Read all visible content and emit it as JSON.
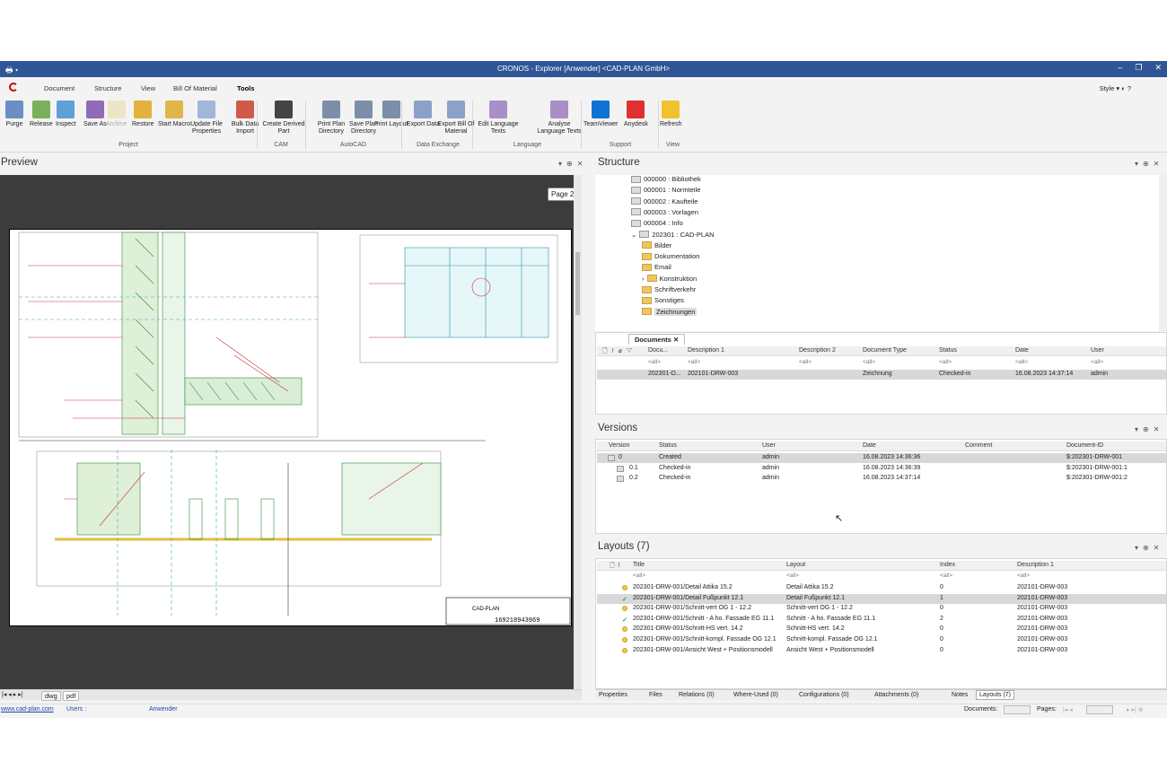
{
  "window": {
    "title": "CRONOS - Explorer [Anwender] <CAD-PLAN GmbH>"
  },
  "menu": {
    "tabs": [
      "Document",
      "Structure",
      "View",
      "Bill Of Material",
      "Tools"
    ],
    "active": "Tools",
    "style_label": "Style"
  },
  "ribbon": {
    "buttons": [
      {
        "label": "Purge",
        "disabled": false,
        "color": "#6b8fc4"
      },
      {
        "label": "Release",
        "disabled": false,
        "color": "#7ab05b"
      },
      {
        "label": "Inspect",
        "disabled": false,
        "color": "#5ea0d8"
      },
      {
        "label": "Save As",
        "disabled": false,
        "color": "#8f6bb8"
      },
      {
        "label": "Archive",
        "disabled": true,
        "color": "#e8d89c"
      },
      {
        "label": "Restore",
        "disabled": false,
        "color": "#e2b23c"
      },
      {
        "label": "Start Macro",
        "disabled": false,
        "color": "#e0b64a"
      },
      {
        "label": "Update File Properties",
        "disabled": false,
        "color": "#9fb7d8"
      },
      {
        "label": "Bulk Data Import",
        "disabled": false,
        "color": "#d05a4a"
      },
      {
        "label": "Create Derived Part",
        "disabled": false,
        "color": "#444444"
      },
      {
        "label": "Print Plan Directory",
        "disabled": false,
        "color": "#7d8fa8"
      },
      {
        "label": "Save Plan Directory",
        "disabled": false,
        "color": "#7d8fa8"
      },
      {
        "label": "Print Layout",
        "disabled": false,
        "color": "#7d8fa8"
      },
      {
        "label": "Export Data",
        "disabled": false,
        "color": "#8aa2c8"
      },
      {
        "label": "Export Bill Of Material",
        "disabled": false,
        "color": "#8aa2c8"
      },
      {
        "label": "Edit Language Texts",
        "disabled": false,
        "color": "#a88fc8"
      },
      {
        "label": "Analyse Language Texts",
        "disabled": false,
        "color": "#a88fc8"
      },
      {
        "label": "TeamViewer",
        "disabled": false,
        "color": "#0e73d4"
      },
      {
        "label": "Anydesk",
        "disabled": false,
        "color": "#e03030"
      },
      {
        "label": "Refresh",
        "disabled": false,
        "color": "#f2c12e"
      }
    ],
    "groups": [
      "Project",
      "CAM",
      "AutoCAD",
      "Data Exchange",
      "Language",
      "Support",
      "View"
    ]
  },
  "preview": {
    "title": "Preview",
    "page_label": "Page 2",
    "tabs": [
      "dwg",
      "pdf"
    ],
    "drawing_number": "169218943969",
    "company": "CAD-PLAN"
  },
  "structure": {
    "title": "Structure",
    "items": [
      {
        "label": "000000 : Bibliothek",
        "icon": "grid-icon"
      },
      {
        "label": "000001 : Normteile",
        "icon": "grid-icon"
      },
      {
        "label": "000002 : Kaufteile",
        "icon": "grid-icon"
      },
      {
        "label": "000003 : Vorlagen",
        "icon": "grid-icon"
      },
      {
        "label": "000004 : Info",
        "icon": "grid-icon"
      },
      {
        "label": "202301 : CAD-PLAN",
        "icon": "grid-icon"
      },
      {
        "label": "Bilder",
        "icon": "folder-icon"
      },
      {
        "label": "Dokumentation",
        "icon": "folder-icon"
      },
      {
        "label": "Email",
        "icon": "folder-icon"
      },
      {
        "label": "Konstruktion",
        "icon": "folder-icon"
      },
      {
        "label": "Schriftverkehr",
        "icon": "folder-icon"
      },
      {
        "label": "Sonstiges",
        "icon": "folder-icon"
      },
      {
        "label": "Zeichnungen",
        "icon": "folder-icon"
      }
    ]
  },
  "documents": {
    "tab": "Documents",
    "columns": [
      "Docu...",
      "Description 1",
      "Description 2",
      "Document Type",
      "Status",
      "Date",
      "User"
    ],
    "filter": "<all>",
    "rows": [
      [
        "202301-D...",
        "202101-DRW-003",
        "",
        "Zeichnung",
        "Checked-in",
        "16.08.2023 14:37:14",
        "admin"
      ]
    ]
  },
  "versions": {
    "title": "Versions",
    "columns": [
      "Version",
      "Status",
      "User",
      "Date",
      "Comment",
      "Document-ID"
    ],
    "rows": [
      [
        "0",
        "Created",
        "admin",
        "16.08.2023 14:36:36",
        "",
        "$:202301-DRW-001"
      ],
      [
        "0.1",
        "Checked-in",
        "admin",
        "16.08.2023 14:36:39",
        "",
        "$:202301-DRW-001:1"
      ],
      [
        "0.2",
        "Checked-in",
        "admin",
        "16.08.2023 14:37:14",
        "",
        "$:202301-DRW-001:2"
      ]
    ]
  },
  "layouts": {
    "title": "Layouts (7)",
    "columns": [
      "Title",
      "Layout",
      "Index",
      "Description 1"
    ],
    "filter": "<all>",
    "rows": [
      [
        "202301-DRW-001/Detail Attika 15.2",
        "Detail Attika 15.2",
        "0",
        "202101-DRW-003",
        "dot"
      ],
      [
        "202301-DRW-001/Detail Fußpunkt 12.1",
        "Detail Fußpunkt 12.1",
        "1",
        "202101-DRW-003",
        "check"
      ],
      [
        "202301-DRW-001/Schnitt-vert OG 1 - 12.2",
        "Schnitt-vert OG 1 - 12.2",
        "0",
        "202101-DRW-003",
        "dot"
      ],
      [
        "202301-DRW-001/Schnitt - A ho. Fassade EG 11.1",
        "Schnitt - A ho. Fassade EG 11.1",
        "2",
        "202101-DRW-003",
        "check"
      ],
      [
        "202301-DRW-001/Schnitt-HS vert. 14.2",
        "Schnitt-HS vert. 14.2",
        "0",
        "202101-DRW-003",
        "dot"
      ],
      [
        "202301-DRW-001/Schnitt-kompl. Fassade OG 12.1",
        "Schnitt-kompl. Fassade OG 12.1",
        "0",
        "202101-DRW-003",
        "dot"
      ],
      [
        "202301-DRW-001/Ansicht West + Positionsmodell",
        "Ansicht West + Positionsmodell",
        "0",
        "202101-DRW-003",
        "dot"
      ]
    ]
  },
  "bottom_tabs": [
    "Properties",
    "Files",
    "Relations (0)",
    "Where-Used (0)",
    "Configurations (0)",
    "Attachments (0)",
    "Notes",
    "Layouts (7)"
  ],
  "status": {
    "link": "www.cad-plan.com",
    "users_label": "Users :",
    "user": "Anwender",
    "documents_label": "Documents:",
    "pages_label": "Pages:"
  }
}
